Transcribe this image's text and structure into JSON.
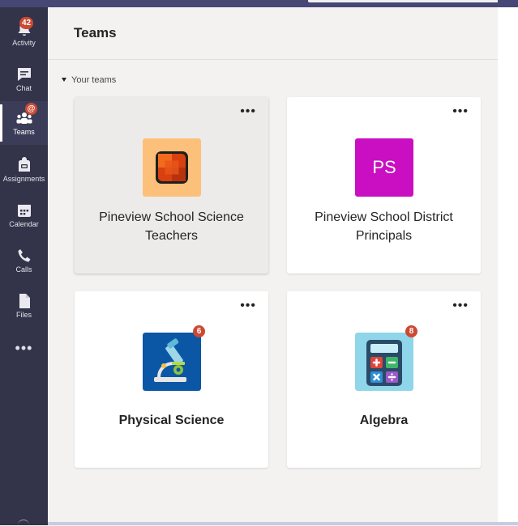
{
  "rail": {
    "activity": {
      "label": "Activity",
      "badge": "42"
    },
    "chat": {
      "label": "Chat"
    },
    "teams": {
      "label": "Teams",
      "badge": "@"
    },
    "assignments": {
      "label": "Assignments"
    },
    "calendar": {
      "label": "Calendar"
    },
    "calls": {
      "label": "Calls"
    },
    "files": {
      "label": "Files"
    },
    "more": "•••"
  },
  "header": {
    "title": "Teams"
  },
  "section": {
    "label": "Your teams"
  },
  "teams": [
    {
      "name_line1": "Pineview School Science",
      "name_line2": "Teachers",
      "more": "•••",
      "icon": "office-tile-icon"
    },
    {
      "name_line1": "Pineview School District",
      "name_line2": "Principals",
      "more": "•••",
      "initials": "PS"
    },
    {
      "name": "Physical Science",
      "more": "•••",
      "badge": "6",
      "icon": "microscope-icon"
    },
    {
      "name": "Algebra",
      "more": "•••",
      "badge": "8",
      "icon": "calculator-icon"
    }
  ],
  "colors": {
    "rail": "#33344a",
    "accent": "#6264a7",
    "badge": "#cc4a31",
    "ps_tile": "#c90fc1"
  }
}
